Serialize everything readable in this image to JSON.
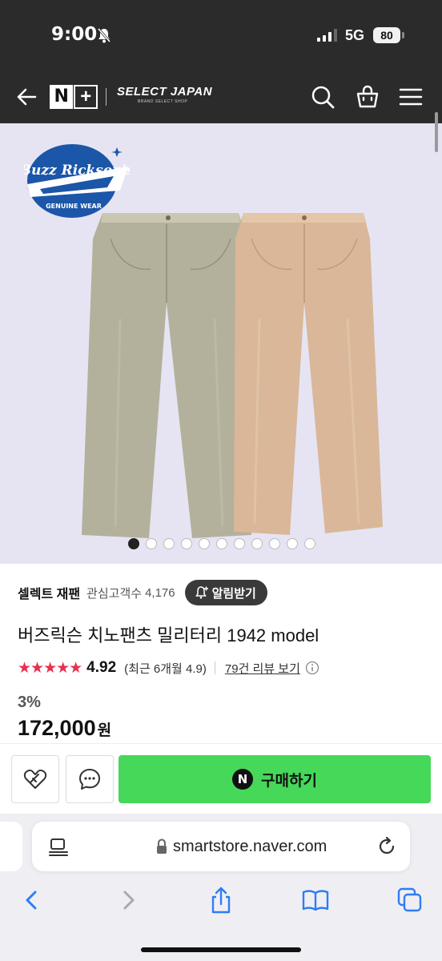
{
  "status_bar": {
    "time": "9:00",
    "network": "5G",
    "battery": "80"
  },
  "header": {
    "brand_n": "N",
    "brand_plus": "+",
    "store_name": "SELECT JAPAN",
    "store_tagline": "BRAND SELECT SHOP",
    "icons": [
      "back-arrow-icon",
      "search-icon",
      "shopping-bag-icon",
      "menu-icon"
    ]
  },
  "product_image": {
    "logo_text": "Buzz Rickson's",
    "logo_subtext": "GENUINE WEAR",
    "carousel": {
      "total": 11,
      "active": 1
    },
    "background": "#e6e4f3"
  },
  "product": {
    "seller": "셀렉트 재팬",
    "interest_label": "관심고객수",
    "interest_count": "4,176",
    "alert_button": "알림받기",
    "title": "버즈릭슨 치노팬츠 밀리터리 1942 model",
    "stars": "★★★★★",
    "rating": "4.92",
    "recent_rating": "(최근 6개월 4.9)",
    "review_link": "79건 리뷰 보기",
    "discount": "3%",
    "price": "172,000",
    "price_unit": "원"
  },
  "purchase_bar": {
    "buy_button": "구매하기",
    "n_logo": "N",
    "accent": "#45d859"
  },
  "browser": {
    "url": "smartstore.naver.com",
    "toolbar": [
      "back-icon",
      "forward-icon",
      "share-icon",
      "bookmarks-icon",
      "tabs-icon"
    ]
  }
}
